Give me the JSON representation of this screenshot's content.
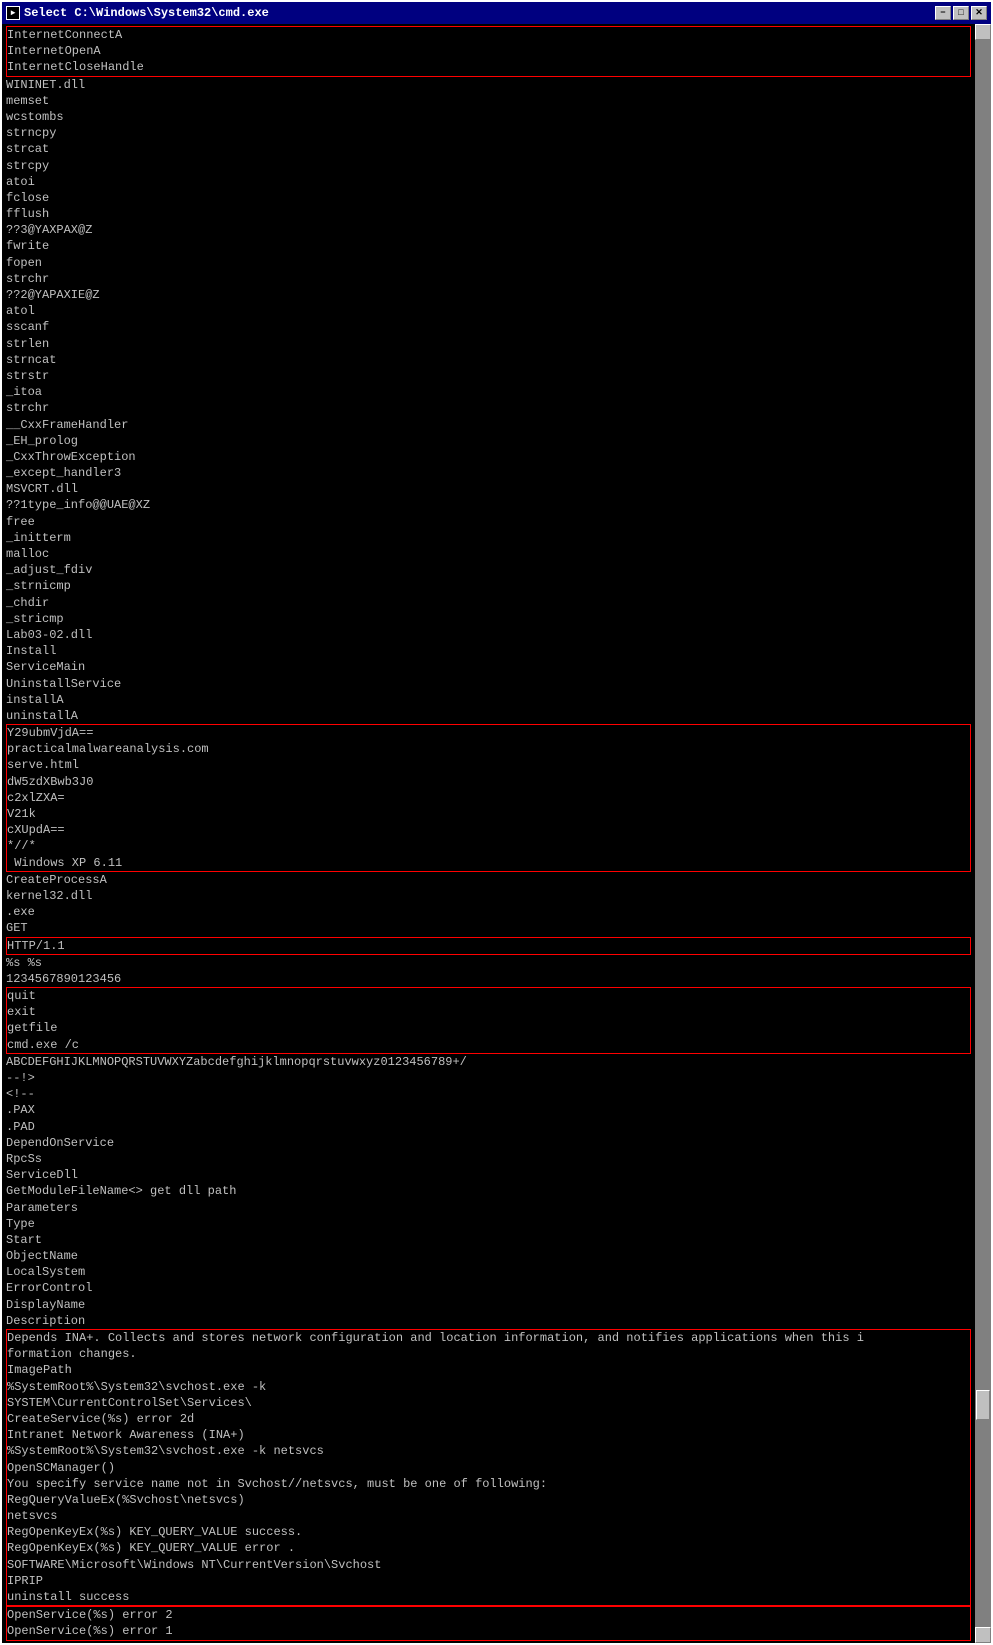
{
  "window": {
    "title": "Select C:\\Windows\\System32\\cmd.exe",
    "icon": "►"
  },
  "buttons": {
    "minimize": "−",
    "maximize": "□",
    "close": "✕"
  },
  "console": {
    "lines": [
      {
        "text": "InternetConnectA",
        "highlight": "box1"
      },
      {
        "text": "InternetOpenA",
        "highlight": "box1"
      },
      {
        "text": "InternetCloseHandle",
        "highlight": "box1"
      },
      {
        "text": "WININET.dll",
        "highlight": ""
      },
      {
        "text": "memset",
        "highlight": ""
      },
      {
        "text": "wcstombs",
        "highlight": ""
      },
      {
        "text": "strncpy",
        "highlight": ""
      },
      {
        "text": "strcat",
        "highlight": ""
      },
      {
        "text": "strcpy",
        "highlight": ""
      },
      {
        "text": "atoi",
        "highlight": ""
      },
      {
        "text": "fclose",
        "highlight": ""
      },
      {
        "text": "fflush",
        "highlight": ""
      },
      {
        "text": "??3@YAXPAX@Z",
        "highlight": ""
      },
      {
        "text": "fwrite",
        "highlight": ""
      },
      {
        "text": "fopen",
        "highlight": ""
      },
      {
        "text": "strchr",
        "highlight": ""
      },
      {
        "text": "??2@YAPAXIE@Z",
        "highlight": ""
      },
      {
        "text": "atol",
        "highlight": ""
      },
      {
        "text": "sscanf",
        "highlight": ""
      },
      {
        "text": "strlen",
        "highlight": ""
      },
      {
        "text": "strncat",
        "highlight": ""
      },
      {
        "text": "strstr",
        "highlight": ""
      },
      {
        "text": "_itoa",
        "highlight": ""
      },
      {
        "text": "strchr",
        "highlight": ""
      },
      {
        "text": "__CxxFrameHandler",
        "highlight": ""
      },
      {
        "text": "_EH_prolog",
        "highlight": ""
      },
      {
        "text": "_CxxThrowException",
        "highlight": ""
      },
      {
        "text": "_except_handler3",
        "highlight": ""
      },
      {
        "text": "MSVCRT.dll",
        "highlight": ""
      },
      {
        "text": "??1type_info@@UAE@XZ",
        "highlight": ""
      },
      {
        "text": "free",
        "highlight": ""
      },
      {
        "text": "_initterm",
        "highlight": ""
      },
      {
        "text": "malloc",
        "highlight": ""
      },
      {
        "text": "_adjust_fdiv",
        "highlight": ""
      },
      {
        "text": "_strnicmp",
        "highlight": ""
      },
      {
        "text": "_chdir",
        "highlight": ""
      },
      {
        "text": "_stricmp",
        "highlight": ""
      },
      {
        "text": "Lab03-02.dll",
        "highlight": ""
      },
      {
        "text": "Install",
        "highlight": ""
      },
      {
        "text": "ServiceMain",
        "highlight": ""
      },
      {
        "text": "UninstallService",
        "highlight": ""
      },
      {
        "text": "installA",
        "highlight": ""
      },
      {
        "text": "uninstallA",
        "highlight": ""
      },
      {
        "text": "Y29ubmVjdA==",
        "highlight": "box2"
      },
      {
        "text": "practicalmalwareanalysis.com",
        "highlight": "box2"
      },
      {
        "text": "serve.html",
        "highlight": "box2"
      },
      {
        "text": "dW5zdXBwb3J0",
        "highlight": "box2"
      },
      {
        "text": "c2xlZXA=",
        "highlight": "box2"
      },
      {
        "text": "V21k",
        "highlight": "box2"
      },
      {
        "text": "cXUpdA==",
        "highlight": "box2"
      },
      {
        "text": "*//*",
        "highlight": "box2"
      },
      {
        "text": " Windows XP 6.11",
        "highlight": "box2"
      },
      {
        "text": "CreateProcessA",
        "highlight": ""
      },
      {
        "text": "kernel32.dll",
        "highlight": ""
      },
      {
        "text": ".exe",
        "highlight": ""
      },
      {
        "text": "GET",
        "highlight": ""
      },
      {
        "text": "HTTP/1.1",
        "highlight": "box3"
      },
      {
        "text": "%s %s",
        "highlight": ""
      },
      {
        "text": "1234567890123456",
        "highlight": ""
      },
      {
        "text": "quit",
        "highlight": "box4"
      },
      {
        "text": "exit",
        "highlight": "box4"
      },
      {
        "text": "getfile",
        "highlight": "box4"
      },
      {
        "text": "cmd.exe /c",
        "highlight": "box4"
      },
      {
        "text": "ABCDEFGHIJKLMNOPQRSTUVWXYZabcdefghijklmnopqrstuvwxyz0123456789+/",
        "highlight": ""
      },
      {
        "text": "--!>",
        "highlight": ""
      },
      {
        "text": "<!--",
        "highlight": ""
      },
      {
        "text": ".PAX",
        "highlight": ""
      },
      {
        "text": ".PAD",
        "highlight": ""
      },
      {
        "text": "DependOnService",
        "highlight": ""
      },
      {
        "text": "RpcSs",
        "highlight": ""
      },
      {
        "text": "ServiceDll",
        "highlight": ""
      },
      {
        "text": "GetModuleFileName<> get dll path",
        "highlight": ""
      },
      {
        "text": "Parameters",
        "highlight": ""
      },
      {
        "text": "Type",
        "highlight": ""
      },
      {
        "text": "Start",
        "highlight": ""
      },
      {
        "text": "ObjectName",
        "highlight": ""
      },
      {
        "text": "LocalSystem",
        "highlight": ""
      },
      {
        "text": "ErrorControl",
        "highlight": ""
      },
      {
        "text": "DisplayName",
        "highlight": ""
      },
      {
        "text": "Description",
        "highlight": ""
      },
      {
        "text": "Depends INA+. Collects and stores network configuration and location information, and notifies applications when this i",
        "highlight": "box5"
      },
      {
        "text": "formation changes.",
        "highlight": "box5"
      },
      {
        "text": "ImagePath",
        "highlight": "box5"
      },
      {
        "text": "%SystemRoot%\\System32\\svchost.exe -k",
        "highlight": "box5"
      },
      {
        "text": "SYSTEM\\CurrentControlSet\\Services\\",
        "highlight": "box5"
      },
      {
        "text": "CreateService(%s) error 2d",
        "highlight": "box5"
      },
      {
        "text": "Intranet Network Awareness (INA+)",
        "highlight": "box5"
      },
      {
        "text": "%SystemRoot%\\System32\\svchost.exe -k netsvcs",
        "highlight": "box5"
      },
      {
        "text": "OpenSCManager()",
        "highlight": "box5"
      },
      {
        "text": "You specify service name not in Svchost//netsvcs, must be one of following:",
        "highlight": "box5"
      },
      {
        "text": "RegQueryValueEx(%Svchost\\netsvcs)",
        "highlight": "box5"
      },
      {
        "text": "netsvcs",
        "highlight": "box5"
      },
      {
        "text": "RegOpenKeyEx(%s) KEY_QUERY_VALUE success.",
        "highlight": "box5"
      },
      {
        "text": "RegOpenKeyEx(%s) KEY_QUERY_VALUE error .",
        "highlight": "box5"
      },
      {
        "text": "SOFTWARE\\Microsoft\\Windows NT\\CurrentVersion\\Svchost",
        "highlight": "box5"
      },
      {
        "text": "IPRIP",
        "highlight": "box5"
      },
      {
        "text": "uninstall success",
        "highlight": "box5"
      },
      {
        "text": "OpenService(%s) error 2",
        "highlight": "box6"
      },
      {
        "text": "OpenService(%s) error 1",
        "highlight": "box6"
      }
    ]
  }
}
